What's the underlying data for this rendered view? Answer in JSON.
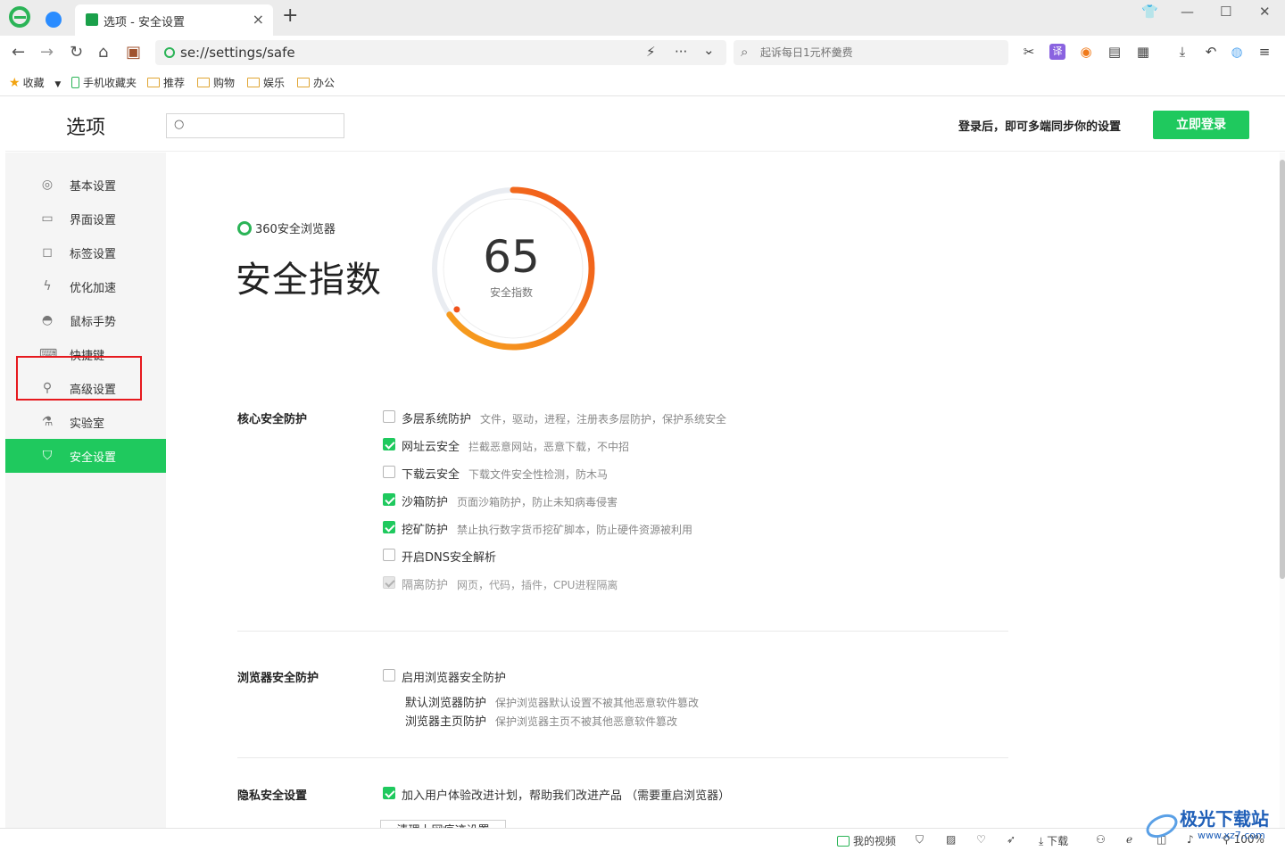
{
  "tab": {
    "title": "选项 - 安全设置",
    "close": "×",
    "new_tab": "+"
  },
  "window_controls": {
    "skin": "⌂",
    "minimize": "—",
    "maximize": "☐",
    "close": "✕"
  },
  "toolbar": {
    "back": "←",
    "forward": "→",
    "refresh": "↻",
    "home": "⌂",
    "address": "se://settings/safe",
    "lightning": "⚡",
    "more": "···",
    "dropdown": "⌄",
    "search_placeholder": "起诉每日1元杯羹费"
  },
  "toolbar_icons": [
    "cut-icon",
    "translate-icon",
    "game-icon",
    "reader-icon",
    "apps-icon",
    "download-icon",
    "undo-icon",
    "profile-icon",
    "menu-icon"
  ],
  "bookmarks": {
    "favorites": "收藏",
    "mobile": "手机收藏夹",
    "folders": [
      "推荐",
      "购物",
      "娱乐",
      "办公"
    ]
  },
  "header": {
    "title": "选项",
    "search_placeholder": "",
    "login_hint": "登录后，即可多端同步你的设置",
    "login_button": "立即登录"
  },
  "sidebar": {
    "items": [
      {
        "label": "基本设置",
        "icon": "◎"
      },
      {
        "label": "界面设置",
        "icon": "▭"
      },
      {
        "label": "标签设置",
        "icon": "◻"
      },
      {
        "label": "优化加速",
        "icon": "ϟ"
      },
      {
        "label": "鼠标手势",
        "icon": "◓"
      },
      {
        "label": "快捷键",
        "icon": "⌨"
      },
      {
        "label": "高级设置",
        "icon": "⚲"
      },
      {
        "label": "实验室",
        "icon": "⚗"
      },
      {
        "label": "安全设置",
        "icon": "⛉"
      }
    ]
  },
  "hero": {
    "brand": "360安全浏览器",
    "title": "安全指数",
    "score": "65",
    "score_label": "安全指数",
    "score_value": 65,
    "ring_start": "#f7a21e",
    "ring_end": "#f0531c"
  },
  "core": {
    "title": "核心安全防护",
    "options": [
      {
        "label": "多层系统防护",
        "desc": "文件，驱动，进程，注册表多层防护，保护系统安全",
        "checked": false,
        "disabled": false
      },
      {
        "label": "网址云安全",
        "desc": "拦截恶意网站，恶意下载，不中招",
        "checked": true,
        "disabled": false
      },
      {
        "label": "下载云安全",
        "desc": "下载文件安全性检测，防木马",
        "checked": false,
        "disabled": false
      },
      {
        "label": "沙箱防护",
        "desc": "页面沙箱防护，防止未知病毒侵害",
        "checked": true,
        "disabled": false
      },
      {
        "label": "挖矿防护",
        "desc": "禁止执行数字货币挖矿脚本，防止硬件资源被利用",
        "checked": true,
        "disabled": false
      },
      {
        "label": "开启DNS安全解析",
        "desc": "",
        "checked": false,
        "disabled": false
      },
      {
        "label": "隔离防护",
        "desc": "网页，代码，插件，CPU进程隔离",
        "checked": true,
        "disabled": true
      }
    ]
  },
  "browser_sec": {
    "title": "浏览器安全防护",
    "main_option": "启用浏览器安全防护",
    "sub": [
      {
        "label": "默认浏览器防护",
        "desc": "保护浏览器默认设置不被其他恶意软件篡改"
      },
      {
        "label": "浏览器主页防护",
        "desc": "保护浏览器主页不被其他恶意软件篡改"
      }
    ]
  },
  "privacy": {
    "title": "隐私安全设置",
    "option": "加入用户体验改进计划，帮助我们改进产品 （需要重启浏览器）",
    "clear_button": "清理上网痕迹设置"
  },
  "statusbar": {
    "video": "我的视频",
    "download": "下载",
    "zoom": "100%"
  },
  "watermark": {
    "name": "极光下载站",
    "url": "www.xz7.com"
  },
  "colors": {
    "accent": "#1fc95e",
    "highlight_box": "#e6191e"
  }
}
